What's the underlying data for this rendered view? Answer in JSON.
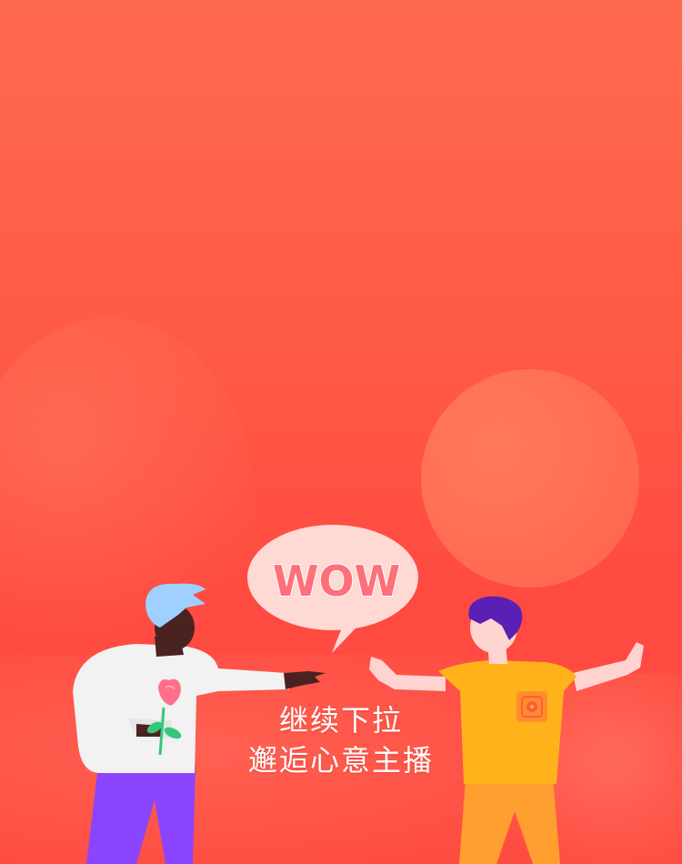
{
  "speech_bubble": {
    "text": "WOW"
  },
  "caption": {
    "line1": "继续下拉",
    "line2": "邂逅心意主播"
  },
  "colors": {
    "background_top": "#ff6a4f",
    "background_bottom": "#ff4a41",
    "bubble": "#ffd9d4",
    "wow_text": "#ff6f7a",
    "left_shirt": "#f2f2f2",
    "left_pants": "#8b45ff",
    "left_hair": "#9fd0ff",
    "left_skin": "#4a2320",
    "right_shirt": "#ffb21a",
    "right_pants": "#ff9f2f",
    "right_hair": "#5a1fb5",
    "right_skin": "#ffd3cf"
  },
  "icons": [
    "rose-icon",
    "pocket-logo-icon"
  ]
}
